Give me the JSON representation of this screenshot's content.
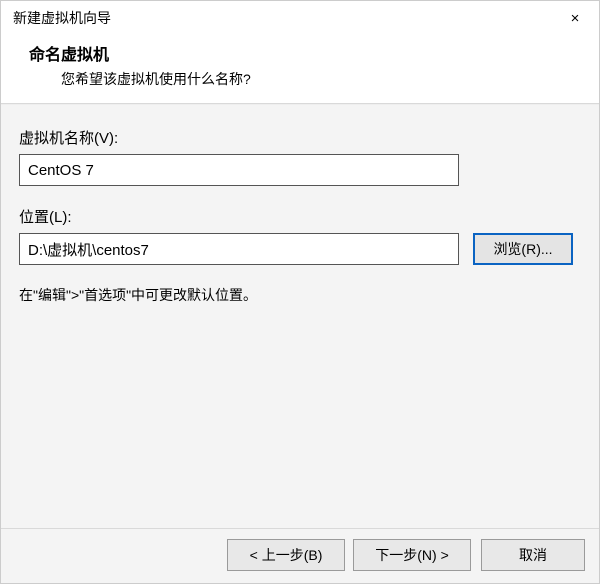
{
  "titlebar": {
    "title": "新建虚拟机向导",
    "close_icon": "×"
  },
  "header": {
    "title": "命名虚拟机",
    "subtitle": "您希望该虚拟机使用什么名称?"
  },
  "fields": {
    "name_label": "虚拟机名称(V):",
    "name_value": "CentOS 7",
    "location_label": "位置(L):",
    "location_value": "D:\\虚拟机\\centos7",
    "browse_label": "浏览(R)..."
  },
  "hint": "在\"编辑\">\"首选项\"中可更改默认位置。",
  "footer": {
    "back": "< 上一步(B)",
    "next": "下一步(N) >",
    "cancel": "取消"
  }
}
